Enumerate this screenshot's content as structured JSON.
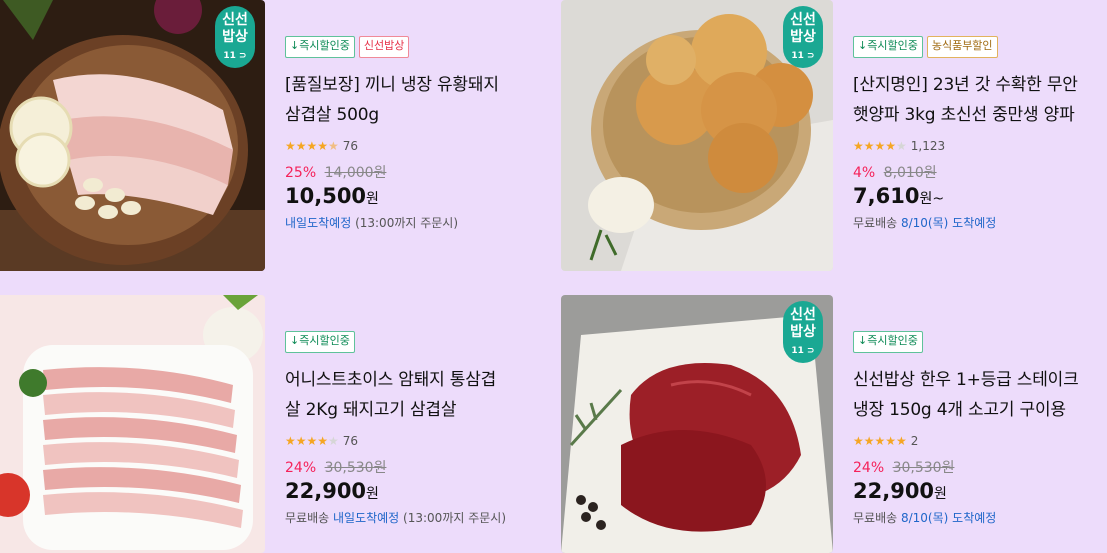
{
  "products": [
    {
      "tags": [
        {
          "label": "↓즉시할인중",
          "style": "green"
        },
        {
          "label": "신선밥상",
          "style": "red"
        }
      ],
      "has_logo": true,
      "title_line1": "[품질보장] 끼니 냉장 유황돼지",
      "title_line2": "삼겹살 500g",
      "stars": "★★★★",
      "stars_half": "★",
      "stars_off": "",
      "rating": 4.5,
      "review_count": "76",
      "discount": "25%",
      "original_price": "14,000원",
      "price": "10,500",
      "price_suffix": "원",
      "delivery_prefix": "",
      "delivery_blue": "내일도착예정",
      "delivery_suffix": " (13:00까지 주문시)"
    },
    {
      "tags": [
        {
          "label": "↓즉시할인중",
          "style": "green"
        },
        {
          "label": "농식품부할인",
          "style": "orange"
        }
      ],
      "has_logo": true,
      "title_line1": "[산지명인] 23년 갓 수확한 무안",
      "title_line2": "햇양파 3kg 초신선 중만생 양파",
      "stars": "★★★★",
      "stars_half": "",
      "stars_off": "★",
      "rating": 4,
      "review_count": "1,123",
      "discount": "4%",
      "original_price": "8,010원",
      "price": "7,610",
      "price_suffix": "원~",
      "delivery_prefix": "무료배송 ",
      "delivery_blue": "8/10(목) 도착예정",
      "delivery_suffix": ""
    },
    {
      "tags": [
        {
          "label": "↓즉시할인중",
          "style": "green"
        }
      ],
      "has_logo": false,
      "title_line1": "어니스트초이스 암퇘지 통삼겹",
      "title_line2": "살 2Kg 돼지고기 삼겹살",
      "stars": "★★★★",
      "stars_half": "",
      "stars_off": "★",
      "rating": 4,
      "review_count": "76",
      "discount": "24%",
      "original_price": "30,530원",
      "price": "22,900",
      "price_suffix": "원",
      "delivery_prefix": "무료배송 ",
      "delivery_blue": "내일도착예정",
      "delivery_suffix": " (13:00까지 주문시)"
    },
    {
      "tags": [
        {
          "label": "↓즉시할인중",
          "style": "green"
        }
      ],
      "has_logo": true,
      "title_line1": "신선밥상 한우 1+등급 스테이크",
      "title_line2": "냉장 150g 4개 소고기 구이용",
      "stars": "★★★★★",
      "stars_half": "",
      "stars_off": "",
      "rating": 5,
      "review_count": "2",
      "discount": "24%",
      "original_price": "30,530원",
      "price": "22,900",
      "price_suffix": "원",
      "delivery_prefix": "무료배송 ",
      "delivery_blue": "8/10(목) 도착예정",
      "delivery_suffix": ""
    }
  ],
  "logo": {
    "line1": "신선",
    "line2": "밥상",
    "mini": "11 ⊃"
  }
}
